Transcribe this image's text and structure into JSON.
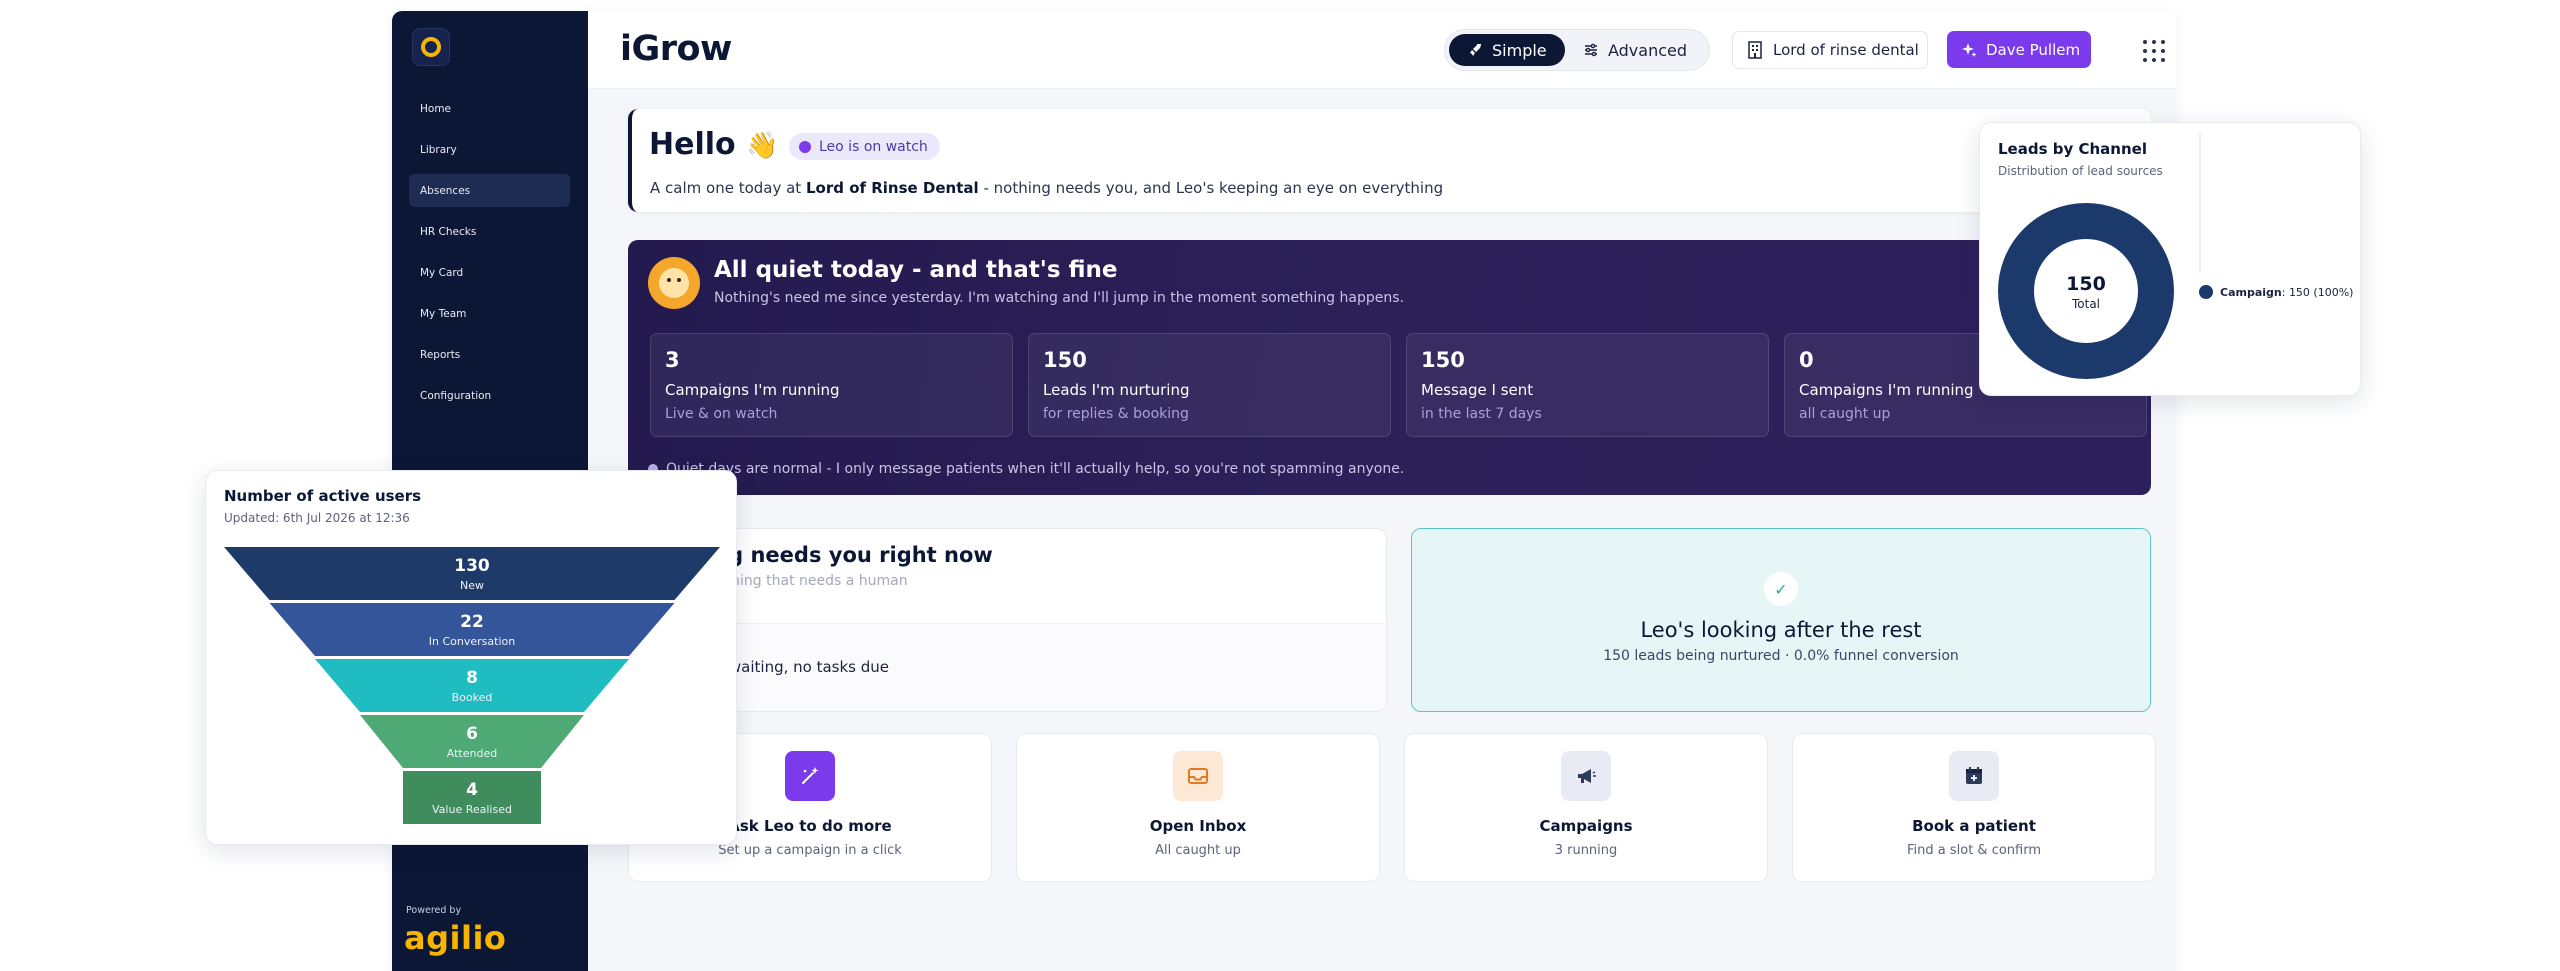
{
  "sidebar": {
    "items": [
      {
        "label": "Home"
      },
      {
        "label": "Library"
      },
      {
        "label": "Absences"
      },
      {
        "label": "HR Checks"
      },
      {
        "label": "My Card"
      },
      {
        "label": "My Team"
      },
      {
        "label": "Reports"
      },
      {
        "label": "Configuration"
      }
    ],
    "active_index": 2,
    "powered_by": "Powered by",
    "brand": "agilio"
  },
  "header": {
    "title": "iGrow",
    "modes": {
      "simple": "Simple",
      "advanced": "Advanced",
      "selected": "Simple"
    },
    "clinic": "Lord of rinse dental",
    "user": "Dave Pullem"
  },
  "hello": {
    "title": "Hello",
    "emoji": "👋",
    "status_pill": "Leo is on watch",
    "message_prefix": "A calm one today at",
    "clinic_bold": "Lord of Rinse Dental",
    "message_suffix": "- nothing needs you, and Leo's keeping an eye on everything"
  },
  "quiet": {
    "title": "All quiet today - and that's fine",
    "subtitle": "Nothing's need me since yesterday. I'm watching and I'll jump in the moment something happens.",
    "stats": [
      {
        "value": "3",
        "label": "Campaigns I'm running",
        "note": "Live & on watch"
      },
      {
        "value": "150",
        "label": "Leads I'm nurturing",
        "note": "for replies & booking"
      },
      {
        "value": "150",
        "label": "Message I sent",
        "note": "in the last 7 days"
      },
      {
        "value": "0",
        "label": "Campaigns I'm running",
        "note": "all caught up"
      }
    ],
    "footer": "Quiet days are normal - I only message patients when it'll actually help, so you're not spamming anyone."
  },
  "needs": {
    "title": "Nothing needs you right now",
    "subtitle": "I'll flag anything that needs a human",
    "body": "No replies waiting, no tasks due"
  },
  "leo": {
    "title": "Leo's looking after the rest",
    "subtitle": "150 leads being nurtured · 0.0% funnel conversion"
  },
  "actions": [
    {
      "title": "Ask Leo to do more",
      "subtitle": "Set up a campaign in a click",
      "icon": "magic-wand-icon",
      "bg": "#7c3aed",
      "fg": "#ffffff"
    },
    {
      "title": "Open Inbox",
      "subtitle": "All caught up",
      "icon": "inbox-icon",
      "bg": "#fde8d6",
      "fg": "#e07b25"
    },
    {
      "title": "Campaigns",
      "subtitle": "3 running",
      "icon": "megaphone-icon",
      "bg": "#e8ebf3",
      "fg": "#2d3a5c"
    },
    {
      "title": "Book a patient",
      "subtitle": "Find a slot & confirm",
      "icon": "calendar-plus-icon",
      "bg": "#e8ebf3",
      "fg": "#2d3a5c"
    }
  ],
  "chart_data": [
    {
      "type": "pie",
      "title": "Leads by Channel",
      "subtitle": "Distribution of lead sources",
      "center_value": "150",
      "center_label": "Total",
      "categories": [
        "Campaign"
      ],
      "values": [
        150
      ],
      "legend_text": [
        "150 (100%)"
      ],
      "colors": [
        "#1b3a6b"
      ]
    },
    {
      "type": "funnel",
      "title": "Number of active users",
      "subtitle": "Updated: 6th Jul 2026 at 12:36",
      "categories": [
        "New",
        "In Conversation",
        "Booked",
        "Attended",
        "Value Realised"
      ],
      "values": [
        130,
        22,
        8,
        6,
        4
      ],
      "colors": [
        "#1e3a68",
        "#34559a",
        "#1fbcc1",
        "#4fa974",
        "#3f8c5c"
      ]
    }
  ]
}
